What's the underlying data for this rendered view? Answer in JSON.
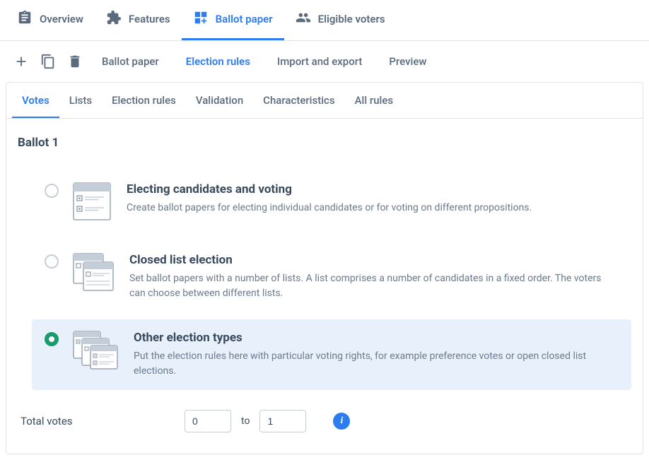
{
  "topTabs": {
    "overview": "Overview",
    "features": "Features",
    "ballot": "Ballot paper",
    "voters": "Eligible voters"
  },
  "actionBar": {
    "ballotPaper": "Ballot paper",
    "electionRules": "Election rules",
    "importExport": "Import and export",
    "preview": "Preview"
  },
  "subTabs": {
    "votes": "Votes",
    "lists": "Lists",
    "electionRules": "Election rules",
    "validation": "Validation",
    "characteristics": "Characteristics",
    "allRules": "All rules"
  },
  "content": {
    "ballotTitle": "Ballot 1",
    "options": {
      "candidates": {
        "title": "Electing candidates and voting",
        "desc": "Create ballot papers for electing individual candidates or for voting on different propositions."
      },
      "closedList": {
        "title": "Closed list election",
        "desc": "Set ballot papers with a number of lists. A list comprises a number of candidates in a fixed order. The voters can choose between different lists."
      },
      "otherTypes": {
        "title": "Other election types",
        "desc": "Put the election rules here with particular voting rights, for example preference votes or open closed list elections."
      }
    },
    "totalVotes": {
      "label": "Total votes",
      "from": "0",
      "toLabel": "to",
      "to": "1"
    }
  }
}
